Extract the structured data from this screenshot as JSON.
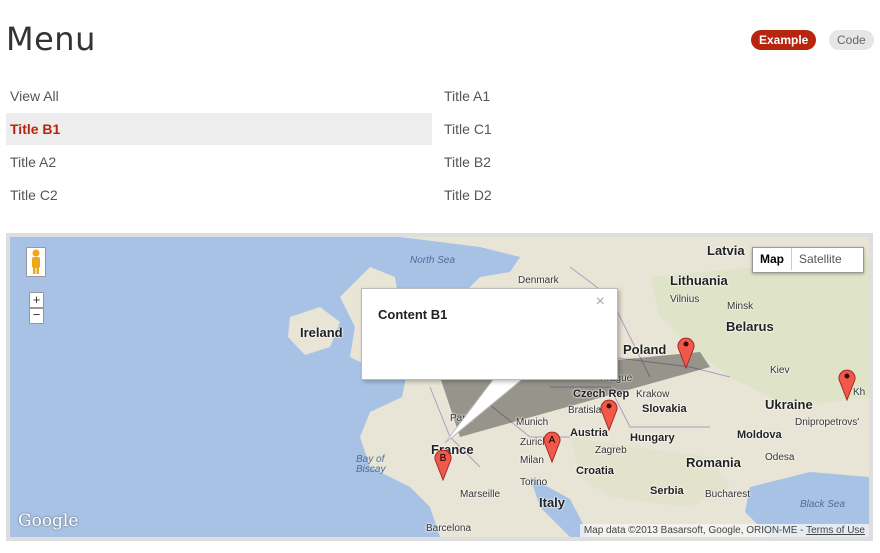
{
  "header": {
    "title": "Menu",
    "example_label": "Example",
    "code_label": "Code"
  },
  "menu": {
    "left": [
      "View All",
      "Title B1",
      "Title A2",
      "Title C2"
    ],
    "right": [
      "Title A1",
      "Title C1",
      "Title B2",
      "Title D2"
    ],
    "active": "Title B1"
  },
  "map": {
    "map_type": {
      "map_label": "Map",
      "satellite_label": "Satellite",
      "selected": "Map"
    },
    "zoom": {
      "in": "+",
      "out": "−"
    },
    "info_window": {
      "content": "Content B1",
      "close": "×"
    },
    "markers": [
      {
        "label": "A"
      },
      {
        "label": "B"
      },
      {
        "label": ""
      },
      {
        "label": ""
      },
      {
        "label": ""
      }
    ],
    "labels": {
      "north_sea": "North Sea",
      "denmark": "Denmark",
      "latvia": "Latvia",
      "lithuania": "Lithuania",
      "vilnius": "Vilnius",
      "minsk": "Minsk",
      "belarus": "Belarus",
      "ireland": "Ireland",
      "poland": "Poland",
      "kiev": "Kiev",
      "ukraine": "Ukraine",
      "dnipropetrovsk": "Dnipropetrovs'",
      "prague": "Prague",
      "czech": "Czech Rep",
      "krakow": "Krakow",
      "paris": "Paris",
      "bratislava": "Bratislava",
      "slovakia": "Slovakia",
      "munich": "Munich",
      "austria": "Austria",
      "hungary": "Hungary",
      "moldova": "Moldova",
      "zurich": "Zurich",
      "france": "France",
      "zagreb": "Zagreb",
      "milan": "Milan",
      "croatia": "Croatia",
      "romania": "Romania",
      "odesa": "Odesa",
      "bay_of_biscay": "Bay of Biscay",
      "torino": "Torino",
      "serbia": "Serbia",
      "bucharest": "Bucharest",
      "marseille": "Marseille",
      "italy": "Italy",
      "black_sea": "Black Sea",
      "barcelona": "Barcelona",
      "kh": "Kh"
    },
    "logo": "Google",
    "attribution": "Map data ©2013 Basarsoft, Google, ORION-ME - ",
    "terms": "Terms of Use"
  }
}
